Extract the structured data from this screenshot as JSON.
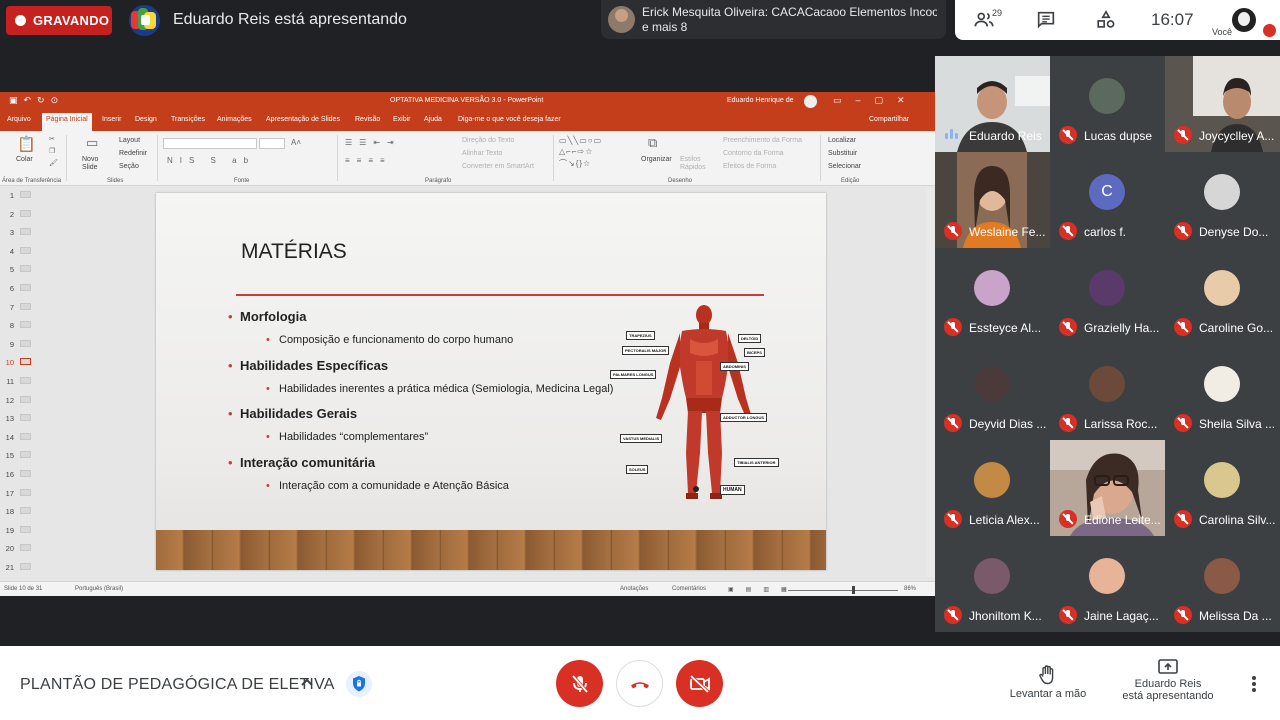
{
  "top_bar": {
    "recording_label": "GRAVANDO",
    "presenter_text": "Eduardo Reis está apresentando",
    "chat_toast_line1": "Erick Mesquita Oliveira: CACACacaoo Elementos Incoo...",
    "chat_toast_line2": "e mais 8",
    "people_count": "29",
    "time": "16:07",
    "self_label": "Você"
  },
  "ppt": {
    "doc_title": "OPTATIVA MEDICINA VERSÃO 3.0  -  PowerPoint",
    "user": "Eduardo Henrique de",
    "tabs": [
      "Arquivo",
      "Página Inicial",
      "Inserir",
      "Design",
      "Transições",
      "Animações",
      "Apresentação de Slides",
      "Revisão",
      "Exibir",
      "Ajuda"
    ],
    "tell_me": "Diga-me o que você deseja fazer",
    "share": "Compartilhar",
    "ribbon": {
      "paste": "Colar",
      "new_slide": "Novo Slide",
      "layout": "Layout",
      "reset": "Redefinir",
      "section": "Seção",
      "text_direction": "Direção do Texto",
      "align_text": "Alinhar Texto",
      "convert_smartart": "Converter em SmartArt",
      "arrange": "Organizar",
      "quick_styles": "Estilos Rápidos",
      "shape_fill": "Preenchimento da Forma",
      "shape_outline": "Contorno da Forma",
      "shape_effects": "Efeitos de Forma",
      "find": "Localizar",
      "replace": "Substituir",
      "select": "Selecionar",
      "group_clipboard": "Área de Transferência",
      "group_slides": "Slides",
      "group_font": "Fonte",
      "group_paragraph": "Parágrafo",
      "group_drawing": "Desenho",
      "group_editing": "Edição"
    },
    "slide_numbers": [
      "1",
      "2",
      "3",
      "4",
      "5",
      "6",
      "7",
      "8",
      "9",
      "10",
      "11",
      "12",
      "13",
      "14",
      "15",
      "16",
      "17",
      "18",
      "19",
      "20",
      "21"
    ],
    "active_slide": "10",
    "slide": {
      "title": "MATÉRIAS",
      "items": [
        {
          "heading": "Morfologia",
          "sub": "Composição e funcionamento do corpo humano"
        },
        {
          "heading": "Habilidades Específicas",
          "sub": "Habilidades inerentes a prática médica (Semiologia, Medicina Legal)"
        },
        {
          "heading": "Habilidades Gerais",
          "sub": "Habilidades “complementares”"
        },
        {
          "heading": "Interação comunitária",
          "sub": "Interação com a comunidade e Atenção Básica"
        }
      ],
      "anatomy_labels": {
        "trapezius": "TRAPEZIUS",
        "pectoralis": "PECTORALIS MAJOR",
        "deltoid": "DELTÓID",
        "biceps": "BICEPS",
        "abdominis": "ABDOMINIS",
        "palmares": "PALMARES LONGUS",
        "adductor": "ADDUCTOR LONGUS",
        "vastus": "VASTUS MEDIALIS",
        "tibialis": "TIBIALIS ANTERIOR",
        "soleus": "SOLEUS",
        "human": "HUMAN"
      }
    },
    "status": {
      "slide_of": "Slide 10 de 31",
      "language": "Português (Brasil)",
      "notes": "Anotações",
      "comments": "Comentários",
      "zoom": "86%"
    }
  },
  "participants": [
    {
      "name": "Eduardo Reis"
    },
    {
      "name": "Lucas dupse"
    },
    {
      "name": "Joycyclley A..."
    },
    {
      "name": "Weslaine Fe..."
    },
    {
      "name": "carlos f.",
      "initial": "C"
    },
    {
      "name": "Denyse Do..."
    },
    {
      "name": "Essteyce Al..."
    },
    {
      "name": "Grazielly Ha..."
    },
    {
      "name": "Caroline Go..."
    },
    {
      "name": "Deyvid Dias ..."
    },
    {
      "name": "Larissa Roc..."
    },
    {
      "name": "Sheila Silva ..."
    },
    {
      "name": "Leticia Alex..."
    },
    {
      "name": "Edione Leite..."
    },
    {
      "name": "Carolina Silv..."
    },
    {
      "name": "Jhoniltom K..."
    },
    {
      "name": "Jaine Lagaç..."
    },
    {
      "name": "Melissa Da ..."
    }
  ],
  "bottom_bar": {
    "meeting_name": "PLANTÃO DE PEDAGÓGICA DE ELETIVA",
    "raise_hand": "Levantar a mão",
    "presenting_line1": "Eduardo Reis",
    "presenting_line2": "está apresentando"
  },
  "colors": {
    "recording_red": "#c5221f",
    "powerpoint_orange": "#c43e1c",
    "meet_red": "#d93025",
    "speaking_blue": "#8ab4f8"
  }
}
